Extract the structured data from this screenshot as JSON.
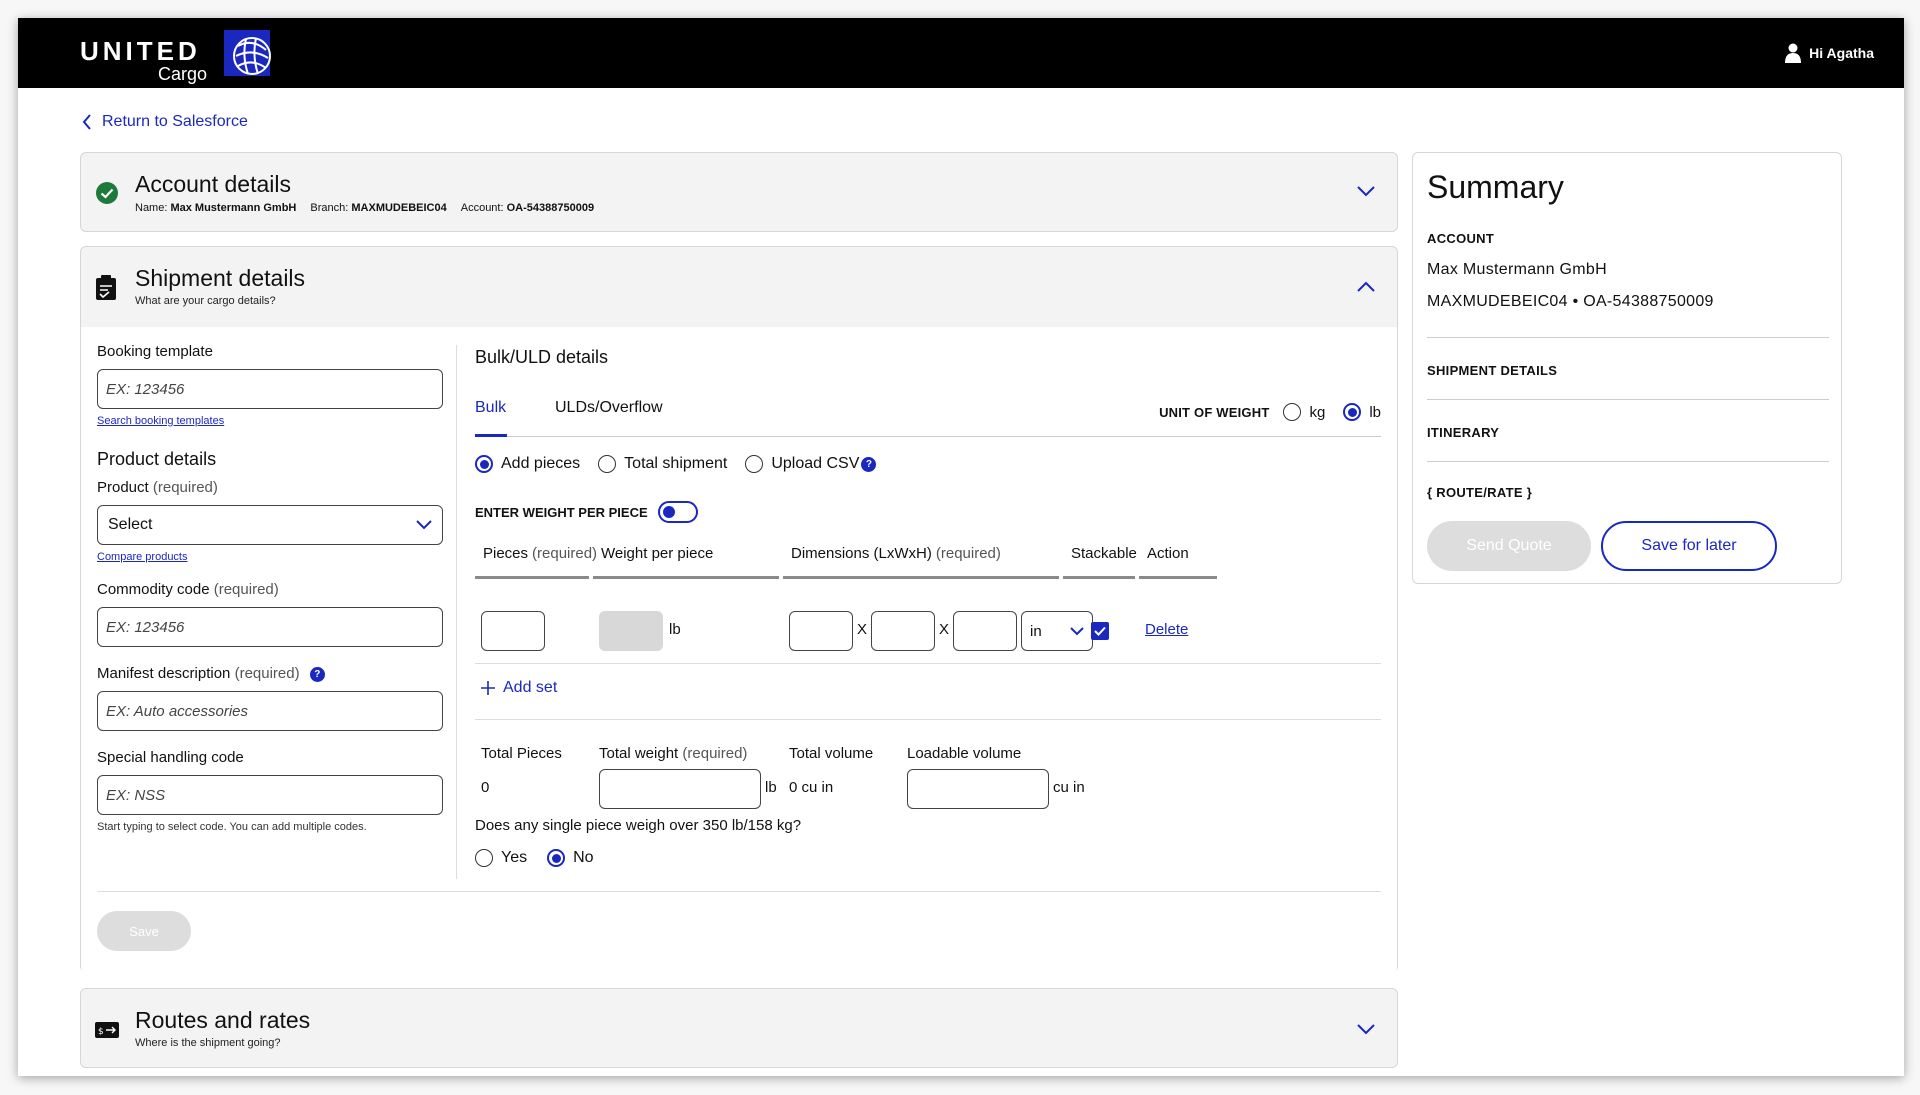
{
  "header": {
    "brand": "UNITED",
    "brand_sub": "Cargo",
    "user_greeting": "Hi Agatha"
  },
  "nav": {
    "back_label": "Return to Salesforce"
  },
  "account_panel": {
    "title": "Account details",
    "name_label": "Name:",
    "name_value": "Max Mustermann GmbH",
    "branch_label": "Branch:",
    "branch_value": "MAXMUDEBEIC04",
    "account_label": "Account:",
    "account_value": "OA-54388750009"
  },
  "shipment_panel": {
    "title": "Shipment details",
    "subtitle": "What are your cargo details?",
    "booking_template": {
      "label": "Booking template",
      "placeholder": "EX: 123456",
      "link": "Search booking templates"
    },
    "product_details_title": "Product details",
    "product": {
      "label": "Product",
      "req": "(required)",
      "value": "Select",
      "link": "Compare products"
    },
    "commodity": {
      "label": "Commodity code",
      "req": "(required)",
      "placeholder": "EX: 123456"
    },
    "manifest": {
      "label": "Manifest description",
      "req": "(required)",
      "placeholder": "EX: Auto accessories",
      "info": "?"
    },
    "handling": {
      "label": "Special handling code",
      "placeholder": "EX: NSS",
      "hint": "Start typing to select code. You can add multiple codes."
    },
    "save_label": "Save"
  },
  "bulk": {
    "title": "Bulk/ULD details",
    "tabs": [
      "Bulk",
      "ULDs/Overflow"
    ],
    "unit_of_weight_label": "UNIT OF WEIGHT",
    "unit_options": [
      "kg",
      "lb"
    ],
    "unit_selected": "lb",
    "modes": [
      "Add pieces",
      "Total shipment",
      "Upload CSV"
    ],
    "mode_selected": "Add pieces",
    "csv_info": "?",
    "weight_per_piece_toggle": "ENTER WEIGHT PER PIECE",
    "columns": {
      "pieces": "Pieces",
      "pieces_req": "(required)",
      "weight": "Weight per piece",
      "dims": "Dimensions (LxWxH)",
      "dims_req": "(required)",
      "stackable": "Stackable",
      "action": "Action"
    },
    "row": {
      "weight_unit": "lb",
      "x1": "X",
      "x2": "X",
      "dim_unit": "in",
      "stackable": true,
      "delete_label": "Delete"
    },
    "add_set_label": "Add set",
    "totals": {
      "pieces_label": "Total Pieces",
      "pieces_value": "0",
      "weight_label": "Total weight",
      "weight_req": "(required)",
      "weight_unit": "lb",
      "volume_label": "Total volume",
      "volume_value": "0 cu in",
      "loadable_label": "Loadable volume",
      "loadable_unit": "cu in"
    },
    "heavy_question": "Does any single piece weigh over 350 lb/158 kg?",
    "heavy_options": [
      "Yes",
      "No"
    ],
    "heavy_selected": "No"
  },
  "routes_panel": {
    "title": "Routes and rates",
    "subtitle": "Where is the shipment going?"
  },
  "summary": {
    "title": "Summary",
    "account_heading": "ACCOUNT",
    "account_name": "Max Mustermann GmbH",
    "account_line": "MAXMUDEBEIC04 • OA-54388750009",
    "shipment_heading": "SHIPMENT DETAILS",
    "itinerary_heading": "ITINERARY",
    "route_heading": "{ ROUTE/RATE }",
    "send_quote_label": "Send Quote",
    "save_later_label": "Save for later"
  },
  "colors": {
    "accent": "#1a28c0",
    "header_bg": "#000000",
    "success": "#1e7a3a",
    "disabled": "#dddddd"
  }
}
